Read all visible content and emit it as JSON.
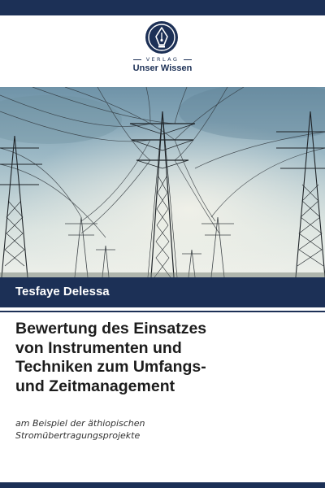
{
  "colors": {
    "brand": "#1c3056",
    "sky_top": "#8fb0c2",
    "sky_bottom": "#eef1ee"
  },
  "publisher": {
    "icon": "fountain-pen-nib-icon",
    "label": "VERLAG",
    "name": "Unser Wissen"
  },
  "cover_image": {
    "subject": "power-transmission-towers-photo"
  },
  "author": "Tesfaye Delessa",
  "title_lines": [
    "Bewertung des Einsatzes",
    "von Instrumenten und",
    "Techniken zum Umfangs-",
    "und Zeitmanagement"
  ],
  "subtitle_lines": [
    "am Beispiel der äthiopischen",
    "Stromübertragungsprojekte"
  ]
}
